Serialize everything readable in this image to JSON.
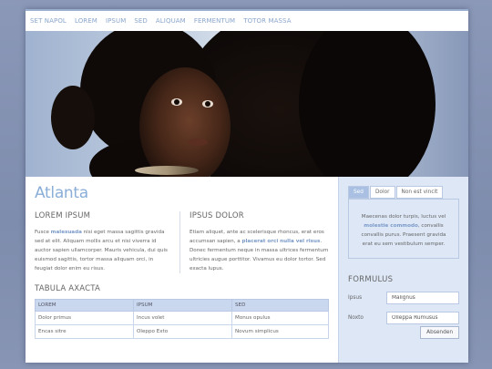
{
  "nav": {
    "items": [
      "SET NAPOL",
      "LOREM",
      "IPSUM",
      "SED",
      "ALIQUAM",
      "FERMENTUM",
      "TOTOR MASSA"
    ]
  },
  "main": {
    "title": "Atlanta",
    "col1": {
      "heading": "LOREM IPSUM",
      "text_before": "Fusce ",
      "highlight": "malesuada",
      "text_after": " nisi eget massa sagittis gravida sed at elit. Aliquam mollis arcu et nisi viverra id auctor sapien ullamcorper. Mauris vehicula, dui quis euismod sagittis, tortor massa aliquam orci, in feugiat dolor enim eu risus."
    },
    "col2": {
      "heading": "IPSUS DOLOR",
      "text_before": "Etiam aliquet, ante ac scelerisque rhoncus, erat eros accumsan sapien, a ",
      "highlight": "placerat orci nulla vel risus",
      "text_after": ". Donec fermentum neque in massa ultrices fermentum ultricies augue porttitor. Vivamus eu dolor tortor. Sed exacta lupus."
    },
    "table": {
      "title": "TABULA AXACTA",
      "headers": [
        "LOREM",
        "IPSUM",
        "SED"
      ],
      "rows": [
        [
          "Dolor primus",
          "Incus volet",
          "Monus opulus"
        ],
        [
          "Encas sitre",
          "Oleppo Exto",
          "Novum simplicus"
        ]
      ]
    }
  },
  "side": {
    "tabs": [
      "Sed",
      "Dolor",
      "Non est vincit"
    ],
    "active_tab": 0,
    "tab_text_before": "Maecenas dolor turpis, luctus vel ",
    "tab_highlight": "molestie commodo",
    "tab_text_after": ", convallis convallis purus. Praesent gravida erat eu sem vestibulum semper.",
    "form": {
      "title": "FORMULUS",
      "fields": [
        {
          "label": "Ipsus",
          "value": "Malignus"
        },
        {
          "label": "Noxto",
          "value": "Olleppa Rumusus"
        }
      ],
      "submit_label": "Absenden"
    }
  },
  "colors": {
    "accent": "#8aaed8",
    "sidebar_bg": "#dde7f6",
    "table_header": "#c9d8ef",
    "background": "#8b98b8"
  }
}
